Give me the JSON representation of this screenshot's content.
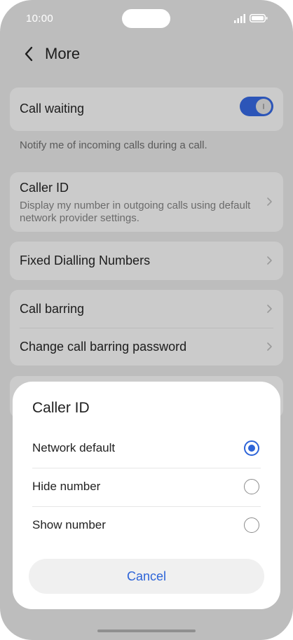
{
  "status_bar": {
    "time": "10:00"
  },
  "header": {
    "title": "More"
  },
  "call_waiting": {
    "label": "Call waiting",
    "enabled": true,
    "description": "Notify me of incoming calls during a call."
  },
  "caller_id": {
    "label": "Caller ID",
    "description": "Display my number in outgoing calls using default network provider settings."
  },
  "fixed_dialling": {
    "label": "Fixed Dialling Numbers"
  },
  "call_barring": {
    "label": "Call barring",
    "password_label": "Change call barring password"
  },
  "dialog": {
    "title": "Caller ID",
    "options": [
      {
        "label": "Network default",
        "selected": true
      },
      {
        "label": "Hide number",
        "selected": false
      },
      {
        "label": "Show number",
        "selected": false
      }
    ],
    "cancel_label": "Cancel"
  },
  "colors": {
    "accent": "#2d64d8",
    "toggle_on": "#2c55b8",
    "overlay": "#bdbdbd"
  }
}
